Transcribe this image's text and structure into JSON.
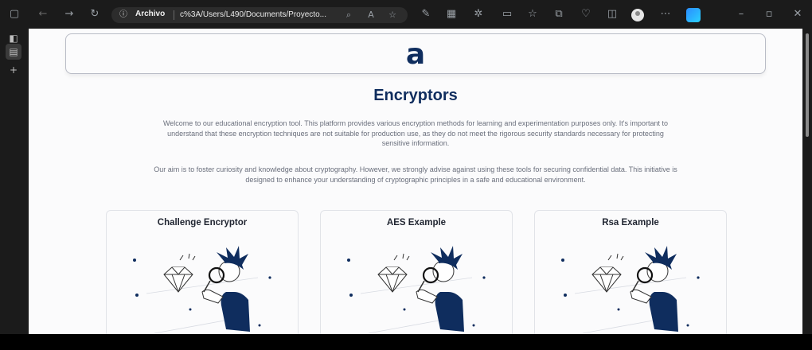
{
  "browser": {
    "address_scheme": "Archivo",
    "address_url": "c%3A/Users/L490/Documents/Proyecto...",
    "icons": {
      "workspaces": "workspaces-icon",
      "back": "back-arrow-icon",
      "forward": "forward-arrow-icon",
      "refresh": "refresh-icon",
      "info": "site-info-icon",
      "zoom": "zoom-icon",
      "read_aloud": "read-aloud-icon",
      "favorite": "star-icon"
    }
  },
  "page": {
    "logo_text": "a",
    "title": "Encryptors",
    "intro": "Welcome to our educational encryption tool. This platform provides various encryption methods for learning and experimentation purposes only. It's important to understand that these encryption techniques are not suitable for production use, as they do not meet the rigorous security standards necessary for protecting sensitive information.",
    "aim": "Our aim is to foster curiosity and knowledge about cryptography. However, we strongly advise against using these tools for securing confidential data. This initiative is designed to enhance your understanding of cryptographic principles in a safe and educational environment.",
    "cards": [
      {
        "title": "Challenge Encryptor"
      },
      {
        "title": "AES Example"
      },
      {
        "title": "Rsa Example"
      }
    ]
  },
  "colors": {
    "brand": "#0f2d5e",
    "chrome_bg": "#1b1b1b",
    "page_bg": "#fbfbfc",
    "accent_blue": "#2b8cff"
  }
}
